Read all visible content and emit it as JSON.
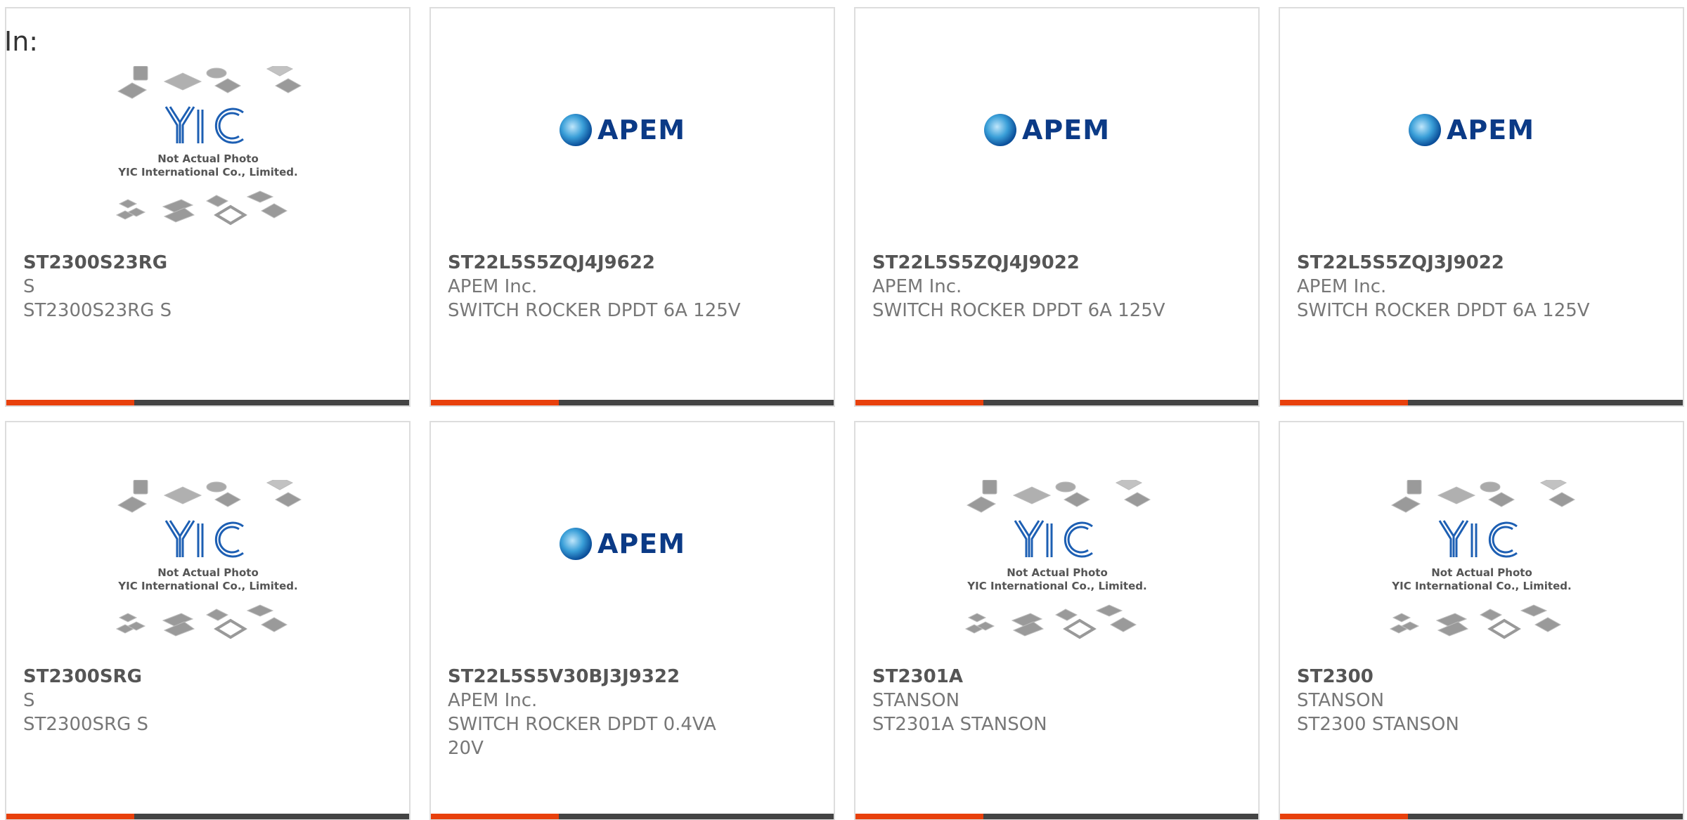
{
  "header": {
    "label": "In:"
  },
  "colors": {
    "accent": "#e8400c",
    "bar": "#444444",
    "border": "#dddddd",
    "apem_blue": "#0b3a86",
    "yic_blue": "#1d5fb3"
  },
  "cards": [
    {
      "image": "yic-placeholder",
      "part_number": "ST2300S23RG",
      "manufacturer": "S",
      "description": "ST2300S23RG S",
      "yic_line1": "Not Actual Photo",
      "yic_line2": "YIC International Co., Limited."
    },
    {
      "image": "apem-logo",
      "logo_text": "APEM",
      "part_number": "ST22L5S5ZQJ4J9622",
      "manufacturer": "APEM Inc.",
      "description": "SWITCH ROCKER DPDT 6A 125V"
    },
    {
      "image": "apem-logo",
      "logo_text": "APEM",
      "part_number": "ST22L5S5ZQJ4J9022",
      "manufacturer": "APEM Inc.",
      "description": "SWITCH ROCKER DPDT 6A 125V"
    },
    {
      "image": "apem-logo",
      "logo_text": "APEM",
      "part_number": "ST22L5S5ZQJ3J9022",
      "manufacturer": "APEM Inc.",
      "description": "SWITCH ROCKER DPDT 6A 125V"
    },
    {
      "image": "yic-placeholder",
      "part_number": "ST2300SRG",
      "manufacturer": "S",
      "description": "ST2300SRG S",
      "yic_line1": "Not Actual Photo",
      "yic_line2": "YIC International Co., Limited."
    },
    {
      "image": "apem-logo",
      "logo_text": "APEM",
      "part_number": "ST22L5S5V30BJ3J9322",
      "manufacturer": "APEM Inc.",
      "description": "SWITCH ROCKER DPDT 0.4VA 20V"
    },
    {
      "image": "yic-placeholder",
      "part_number": "ST2301A",
      "manufacturer": "STANSON",
      "description": "ST2301A STANSON",
      "yic_line1": "Not Actual Photo",
      "yic_line2": "YIC International Co., Limited."
    },
    {
      "image": "yic-placeholder",
      "part_number": "ST2300",
      "manufacturer": "STANSON",
      "description": "ST2300 STANSON",
      "yic_line1": "Not Actual Photo",
      "yic_line2": "YIC International Co., Limited."
    }
  ]
}
